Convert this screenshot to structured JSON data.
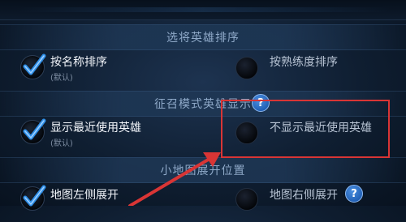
{
  "sections": [
    {
      "title": "选将英雄排序"
    },
    {
      "title": "征召模式英雄显示"
    },
    {
      "title": "小地图展开位置"
    }
  ],
  "hero_sort": {
    "option_name": {
      "label": "按名称排序",
      "note": "(默认)",
      "checked": true
    },
    "option_mastery": {
      "label": "按熟练度排序",
      "checked": false
    }
  },
  "draft_display": {
    "option_show_recent": {
      "label": "显示最近使用英雄",
      "note": "(默认)",
      "checked": true
    },
    "option_hide_recent": {
      "label": "不显示最近使用英雄",
      "checked": false
    },
    "help_icon": "?"
  },
  "minimap": {
    "option_left": {
      "label": "地图左侧展开",
      "checked": true
    },
    "option_right": {
      "label": "地图右侧展开",
      "checked": false
    },
    "help_icon": "?"
  },
  "colors": {
    "accent_check": "#2f8fe8",
    "annotation_red": "#d93535",
    "background": "#0f1e31"
  }
}
